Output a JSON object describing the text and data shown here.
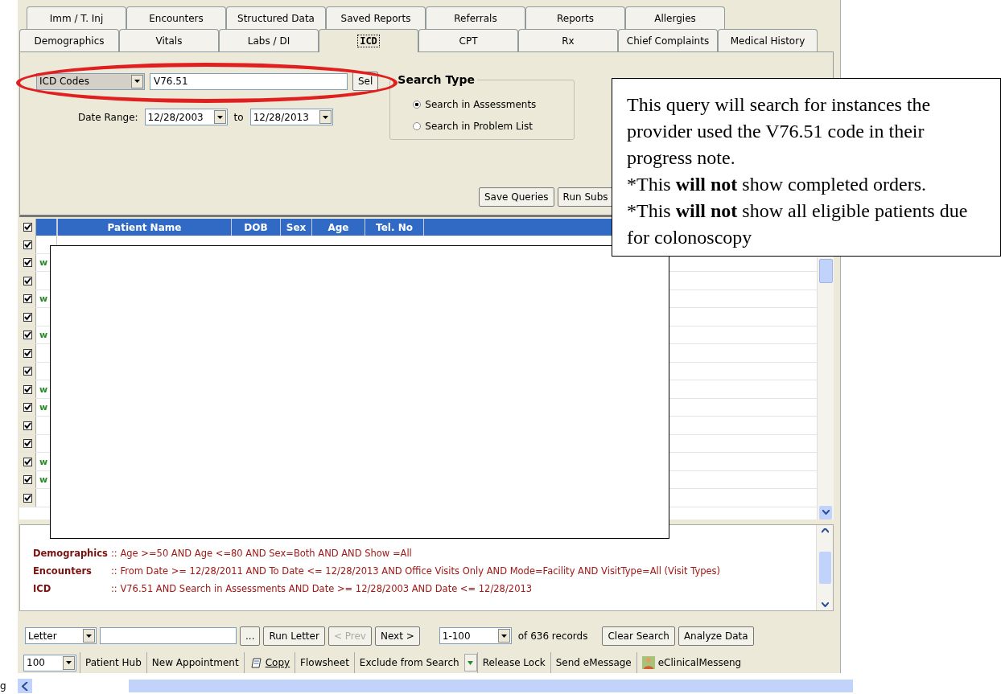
{
  "tab_rows": [
    [
      {
        "label": "Imm / T. Inj",
        "selected": false
      },
      {
        "label": "Encounters",
        "selected": false
      },
      {
        "label": "Structured Data",
        "selected": false
      },
      {
        "label": "Saved Reports",
        "selected": false
      },
      {
        "label": "Referrals",
        "selected": false
      },
      {
        "label": "Reports",
        "selected": false
      },
      {
        "label": "Allergies",
        "selected": false
      }
    ],
    [
      {
        "label": "Demographics",
        "selected": false
      },
      {
        "label": "Vitals",
        "selected": false
      },
      {
        "label": "Labs / DI",
        "selected": false
      },
      {
        "label": "ICD",
        "selected": true
      },
      {
        "label": "CPT",
        "selected": false
      },
      {
        "label": "Rx",
        "selected": false
      },
      {
        "label": "Chief Complaints",
        "selected": false
      },
      {
        "label": "Medical History",
        "selected": false
      }
    ]
  ],
  "search": {
    "code_type": "ICD Codes",
    "code": "V76.51",
    "select_button": "Sel",
    "date_range_label": "Date Range:",
    "date_from": "12/28/2003",
    "to_label": "to",
    "date_to": "12/28/2013"
  },
  "search_type": {
    "title": "Search Type",
    "options": [
      {
        "label": "Search in Assessments",
        "selected": true
      },
      {
        "label": "Search in Problem List",
        "selected": false
      }
    ]
  },
  "panel_buttons": [
    "Save Queries",
    "Run Subs"
  ],
  "table": {
    "all_checked": true,
    "columns": [
      "Patient Name",
      "DOB",
      "Sex",
      "Age",
      "Tel. No"
    ],
    "rows": [
      {
        "checked": true
      },
      {
        "checked": true,
        "column_1": "w"
      },
      {
        "checked": true
      },
      {
        "checked": true,
        "column_1": "w"
      },
      {
        "checked": true
      },
      {
        "checked": true,
        "column_1": "w"
      },
      {
        "checked": true
      },
      {
        "checked": true
      },
      {
        "checked": true,
        "column_1": "w"
      },
      {
        "checked": true,
        "column_1": "w"
      },
      {
        "checked": true
      },
      {
        "checked": true
      },
      {
        "checked": true,
        "column_1": "w"
      },
      {
        "checked": true,
        "column_1": "w"
      },
      {
        "checked": true
      }
    ]
  },
  "criteria": [
    {
      "label": "Demographics",
      "text": ":: Age >=50 AND Age <=80 AND Sex=Both AND AND Show =All"
    },
    {
      "label": "Encounters",
      "text": ":: From Date >= 12/28/2011 AND To Date <= 12/28/2013 AND Office Visits Only AND Mode=Facility AND VisitType=All (Visit Types)"
    },
    {
      "label": "ICD",
      "text": ":: V76.51 AND Search in Assessments AND Date >= 12/28/2003 AND Date <= 12/28/2013"
    }
  ],
  "toolbar_1": [
    {
      "kind": "dropdown",
      "label": "Letter"
    },
    {
      "kind": "input"
    },
    {
      "kind": "button",
      "label": "...",
      "disabled": false
    },
    {
      "kind": "button",
      "label": "Run Letter",
      "disabled": false
    },
    {
      "kind": "button",
      "label": "< Prev",
      "disabled": true
    },
    {
      "kind": "button",
      "label": "Next >",
      "disabled": false
    },
    {
      "kind": "dropdown",
      "label": "1-100"
    },
    {
      "kind": "text",
      "label": "of 636 records"
    },
    {
      "kind": "button",
      "label": "Clear Search",
      "disabled": false
    },
    {
      "kind": "button",
      "label": "Analyze Data",
      "disabled": false
    }
  ],
  "toolbar_2": [
    {
      "kind": "dropdown",
      "label": "100"
    },
    {
      "kind": "button",
      "label": "Patient Hub"
    },
    {
      "kind": "button",
      "label": "New Appointment"
    },
    {
      "kind": "copy",
      "label": "Copy"
    },
    {
      "kind": "button",
      "label": "Flowsheet"
    },
    {
      "kind": "split",
      "label": "Exclude from Search"
    },
    {
      "kind": "button",
      "label": "Release Lock"
    },
    {
      "kind": "button",
      "label": "Send eMessage"
    },
    {
      "kind": "messenger",
      "label": "eClinicalMesseng"
    }
  ],
  "edge_fragment": "g",
  "callout": [
    "This query will search for instances the provider used the V76.51 code in their progress note.",
    "*This **will not** show completed orders.",
    "*This **will not** show all eligible patients due for colonoscopy"
  ]
}
